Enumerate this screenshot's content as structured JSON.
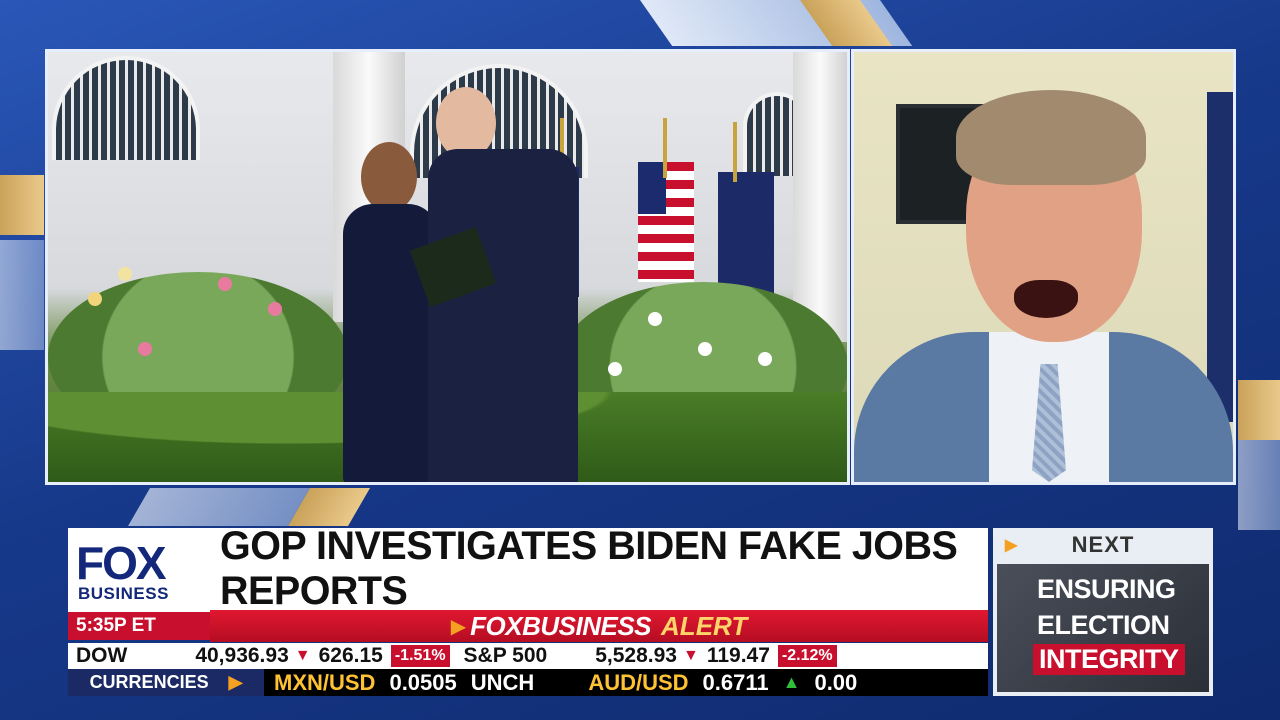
{
  "network": {
    "logo_line1": "FOX",
    "logo_line2": "BUSINESS",
    "time": "5:35P ET"
  },
  "headline": "GOP INVESTIGATES BIDEN FAKE JOBS REPORTS",
  "alert": {
    "brand": "FOXBUSINESS",
    "word": "ALERT"
  },
  "ticker": {
    "stocks": [
      {
        "symbol": "DOW",
        "value": "40,936.93",
        "change": "626.15",
        "pct": "-1.51%"
      },
      {
        "symbol": "S&P 500",
        "value": "5,528.93",
        "change": "119.47",
        "pct": "-2.12%"
      }
    ],
    "currencies_label": "CURRENCIES",
    "currencies": [
      {
        "pair": "MXN/USD",
        "value": "0.0505",
        "change": "UNCH"
      },
      {
        "pair": "AUD/USD",
        "value": "0.6711",
        "change": "0.00"
      }
    ]
  },
  "next": {
    "label": "NEXT",
    "line1": "ENSURING",
    "line2": "ELECTION",
    "line3": "INTEGRITY"
  },
  "colors": {
    "brand_blue": "#13287a",
    "alert_red": "#c8102e",
    "accent_gold": "#f4a020"
  }
}
